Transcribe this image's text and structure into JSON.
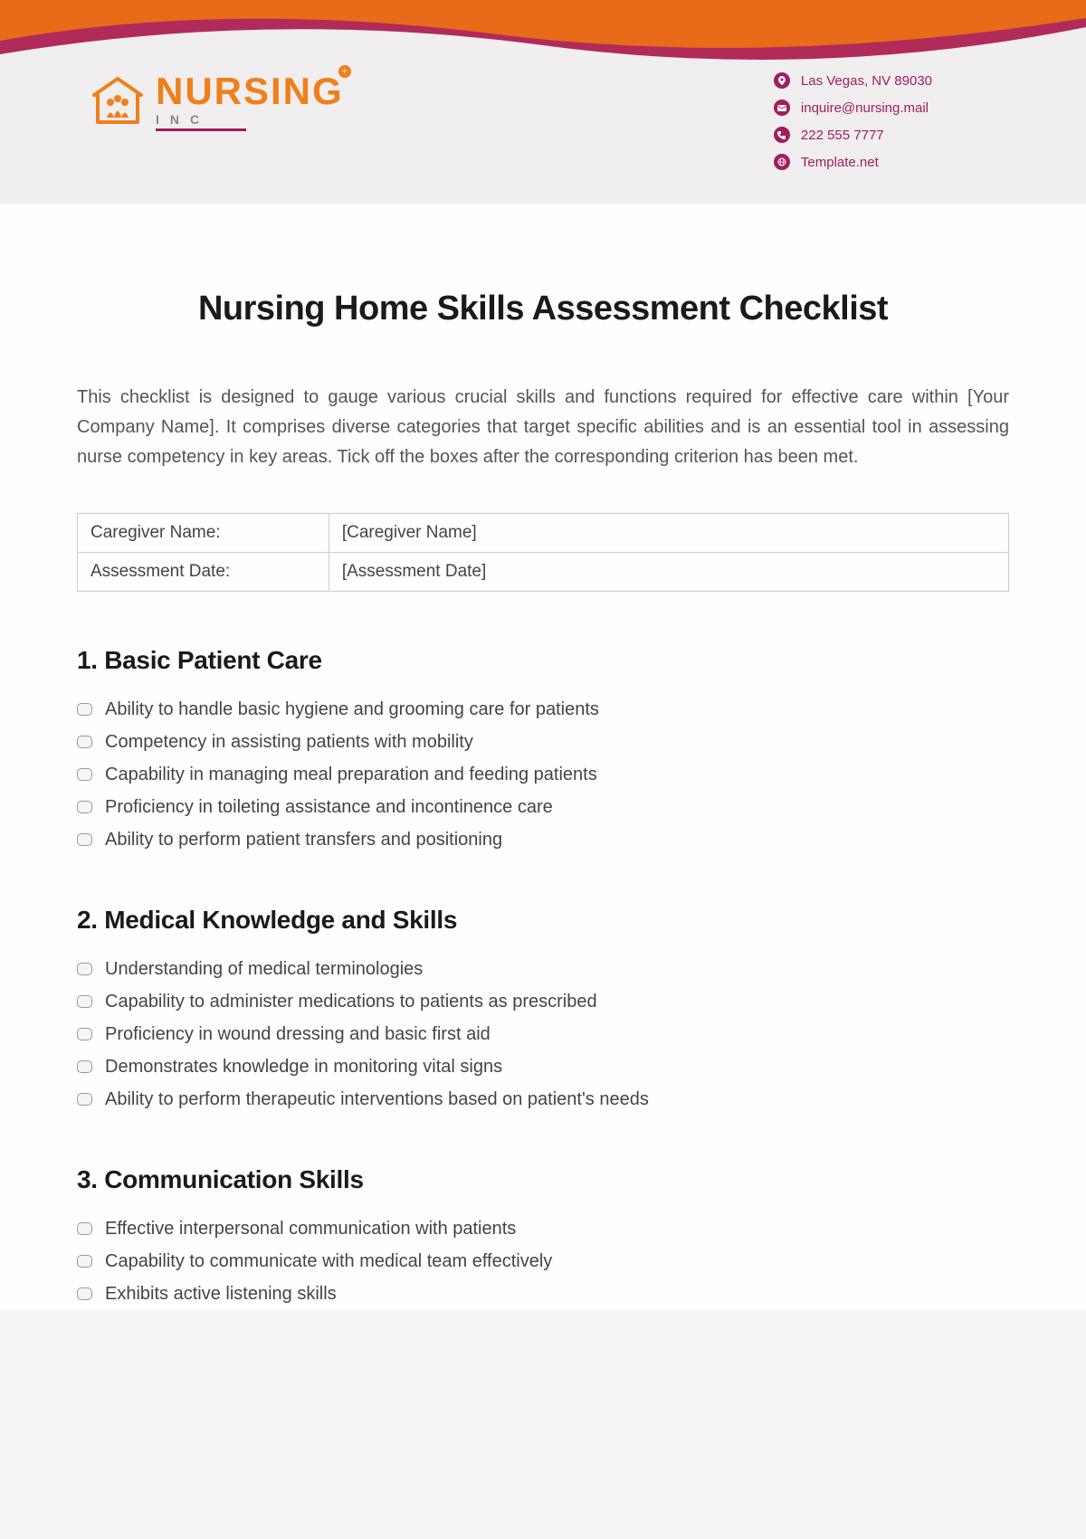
{
  "header": {
    "logo": {
      "main": "NURSING",
      "sub": "INC"
    },
    "contact": {
      "address": "Las Vegas, NV 89030",
      "email": "inquire@nursing.mail",
      "phone": "222 555 7777",
      "web": "Template.net"
    }
  },
  "document": {
    "title": "Nursing Home Skills Assessment Checklist",
    "intro": "This checklist is designed to gauge various crucial skills and functions required for effective care within [Your Company Name]. It comprises diverse categories that target specific abilities and is an essential tool in assessing nurse competency in key areas. Tick off the boxes after the corresponding criterion has been met.",
    "info": {
      "caregiver_label": "Caregiver Name:",
      "caregiver_value": "[Caregiver Name]",
      "date_label": "Assessment Date:",
      "date_value": "[Assessment Date]"
    },
    "sections": [
      {
        "heading": "1. Basic Patient Care",
        "items": [
          "Ability to handle basic hygiene and grooming care for patients",
          "Competency in assisting patients with mobility",
          "Capability in managing meal preparation and feeding patients",
          "Proficiency in toileting assistance and incontinence care",
          "Ability to perform patient transfers and positioning"
        ]
      },
      {
        "heading": "2. Medical Knowledge and Skills",
        "items": [
          "Understanding of medical terminologies",
          "Capability to administer medications to patients as prescribed",
          "Proficiency in wound dressing and basic first aid",
          "Demonstrates knowledge in monitoring vital signs",
          "Ability to perform therapeutic interventions based on patient's needs"
        ]
      },
      {
        "heading": "3. Communication Skills",
        "items": [
          "Effective interpersonal communication with patients",
          "Capability to communicate with medical team effectively",
          "Exhibits active listening skills"
        ]
      }
    ]
  }
}
